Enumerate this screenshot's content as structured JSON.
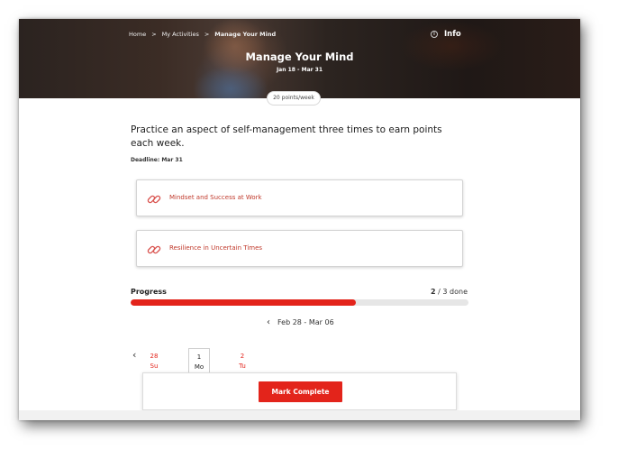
{
  "breadcrumb": {
    "home": "Home",
    "activities": "My Activities",
    "current": "Manage Your Mind",
    "separator": ">"
  },
  "header": {
    "info_label": "Info",
    "info_icon": "i",
    "title": "Manage Your Mind",
    "date_range": "Jan 18 - Mar 31",
    "points_pill": "20 points/week"
  },
  "main": {
    "description": "Practice an aspect of self-management three times to earn points each week.",
    "deadline": "Deadline: Mar 31",
    "links": [
      {
        "label": "Mindset and Success at Work",
        "icon": "link-icon"
      },
      {
        "label": "Resilience in Uncertain Times",
        "icon": "link-icon"
      }
    ]
  },
  "progress": {
    "label": "Progress",
    "done": "2",
    "total_text": " / 3 done",
    "fraction": 0.667
  },
  "week": {
    "prev_icon": "‹",
    "range": "Feb 28 - Mar 06"
  },
  "days": [
    {
      "num": "28",
      "dow": "Su"
    },
    {
      "num": "1",
      "dow": "Mo"
    },
    {
      "num": "2",
      "dow": "Tu"
    }
  ],
  "actions": {
    "mark_complete": "Mark Complete"
  },
  "colors": {
    "accent": "#e3241b",
    "link_text": "#c0392b"
  }
}
